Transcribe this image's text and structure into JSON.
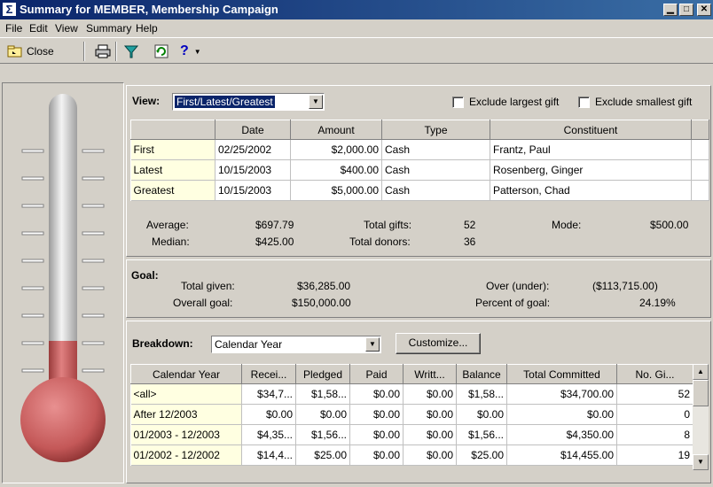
{
  "window": {
    "title": "Summary for MEMBER, Membership Campaign",
    "app_icon": "sigma-icon",
    "controls": [
      "minimize",
      "maximize",
      "close"
    ]
  },
  "menu": [
    "File",
    "Edit",
    "View",
    "Summary",
    "Help"
  ],
  "toolbar": {
    "close_label": "Close",
    "icons": [
      "close-folder-icon",
      "print-icon",
      "filter-icon",
      "refresh-icon",
      "help-icon"
    ]
  },
  "thermometer": {
    "fill_percent": 24.19,
    "colors": {
      "mercury": "#c85a5a",
      "tube": "#d8d8d8"
    }
  },
  "view": {
    "label": "View:",
    "selected": "First/Latest/Greatest",
    "exclude_largest": "Exclude largest gift",
    "exclude_smallest": "Exclude smallest gift",
    "columns": [
      "",
      "Date",
      "Amount",
      "Type",
      "Constituent"
    ],
    "rows": [
      [
        "First",
        "02/25/2002",
        "$2,000.00",
        "Cash",
        "Frantz, Paul"
      ],
      [
        "Latest",
        "10/15/2003",
        "$400.00",
        "Cash",
        "Rosenberg, Ginger"
      ],
      [
        "Greatest",
        "10/15/2003",
        "$5,000.00",
        "Cash",
        "Patterson, Chad"
      ]
    ],
    "stats": {
      "average_label": "Average:",
      "average": "$697.79",
      "median_label": "Median:",
      "median": "$425.00",
      "total_gifts_label": "Total gifts:",
      "total_gifts": "52",
      "total_donors_label": "Total donors:",
      "total_donors": "36",
      "mode_label": "Mode:",
      "mode": "$500.00"
    }
  },
  "goal": {
    "label": "Goal:",
    "total_given_label": "Total given:",
    "total_given": "$36,285.00",
    "overall_goal_label": "Overall goal:",
    "overall_goal": "$150,000.00",
    "over_under_label": "Over (under):",
    "over_under": "($113,715.00)",
    "percent_label": "Percent of goal:",
    "percent": "24.19%"
  },
  "breakdown": {
    "label": "Breakdown:",
    "selected": "Calendar Year",
    "customize_label": "Customize...",
    "columns": [
      "Calendar Year",
      "Recei...",
      "Pledged",
      "Paid",
      "Writt...",
      "Balance",
      "Total Committed",
      "No. Gi..."
    ],
    "rows": [
      [
        "<all>",
        "$34,7...",
        "$1,58...",
        "$0.00",
        "$0.00",
        "$1,58...",
        "$34,700.00",
        "52"
      ],
      [
        "After 12/2003",
        "$0.00",
        "$0.00",
        "$0.00",
        "$0.00",
        "$0.00",
        "$0.00",
        "0"
      ],
      [
        "01/2003 - 12/2003",
        "$4,35...",
        "$1,56...",
        "$0.00",
        "$0.00",
        "$1,56...",
        "$4,350.00",
        "8"
      ],
      [
        "01/2002 - 12/2002",
        "$14,4...",
        "$25.00",
        "$0.00",
        "$0.00",
        "$25.00",
        "$14,455.00",
        "19"
      ]
    ]
  }
}
